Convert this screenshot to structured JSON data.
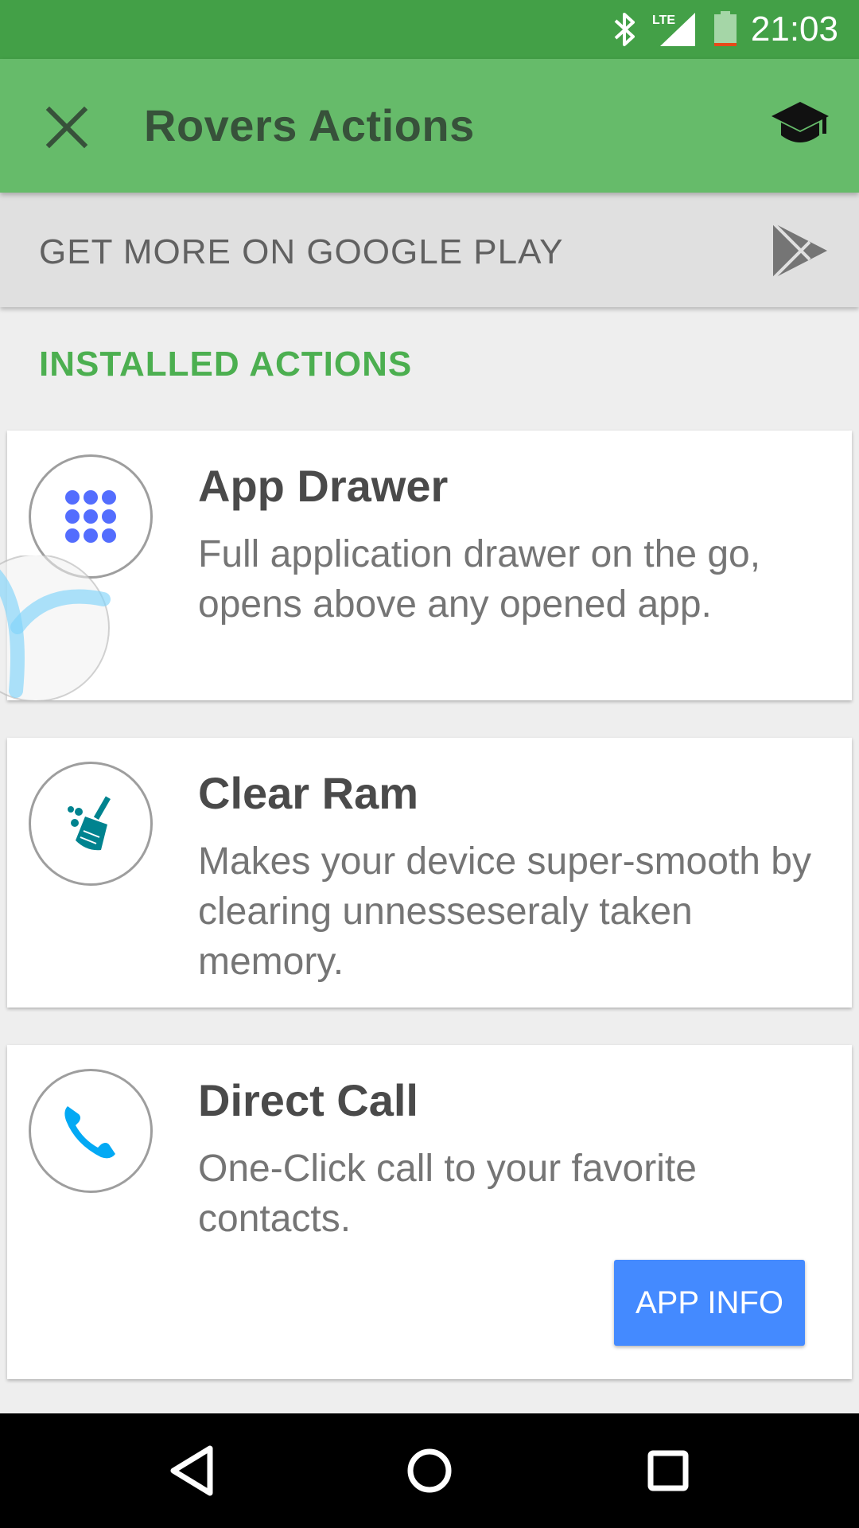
{
  "status_bar": {
    "time": "21:03",
    "icons": [
      "bluetooth-icon",
      "lte-signal-icon",
      "battery-icon"
    ]
  },
  "app_bar": {
    "title": "Rovers Actions",
    "close_icon": "close-icon",
    "help_icon": "school-icon"
  },
  "play_banner": {
    "label": "GET MORE ON GOOGLE PLAY",
    "icon": "play-store-icon"
  },
  "section": {
    "title": "INSTALLED ACTIONS"
  },
  "actions": [
    {
      "name": "App Drawer",
      "description": "Full application drawer on the go, opens above any opened app.",
      "icon": "app-drawer-icon",
      "icon_color": "#536dfe"
    },
    {
      "name": "Clear Ram",
      "description": "Makes your device super-smooth by clearing unnesseseraly taken memory.",
      "icon": "broom-icon",
      "icon_color": "#00838f"
    },
    {
      "name": "Direct Call",
      "description": "One-Click call to your favorite contacts.",
      "icon": "phone-icon",
      "icon_color": "#03a9f4",
      "button": "APP INFO"
    }
  ],
  "colors": {
    "status_bar": "#43a047",
    "app_bar": "#66bb6a",
    "accent_green": "#4caf50",
    "button_blue": "#448aff"
  },
  "nav_bar": {
    "buttons": [
      "back-icon",
      "home-icon",
      "recents-icon"
    ]
  }
}
